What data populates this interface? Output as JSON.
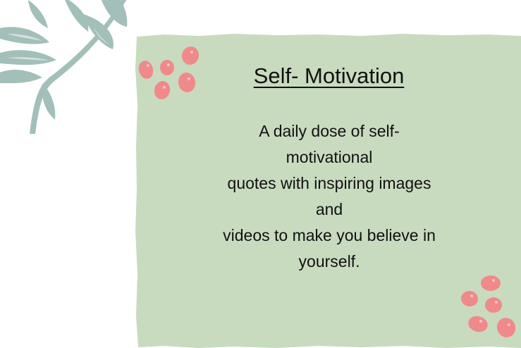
{
  "card": {
    "title": "Self- Motivation",
    "description_lines": [
      "A daily dose of self-",
      "motivational",
      "quotes with inspiring images",
      "and",
      "videos to make you believe in",
      "yourself."
    ]
  },
  "colors": {
    "card_background": "#c8dbbf",
    "leaf": "#a3bfba",
    "dot": "#f08a8a",
    "dot_highlight": "#f7c3c3",
    "text": "#111111"
  },
  "decorations": {
    "leaf_icon": "leaf-branch-icon",
    "dot_cluster_icon": "berry-cluster-icon"
  }
}
